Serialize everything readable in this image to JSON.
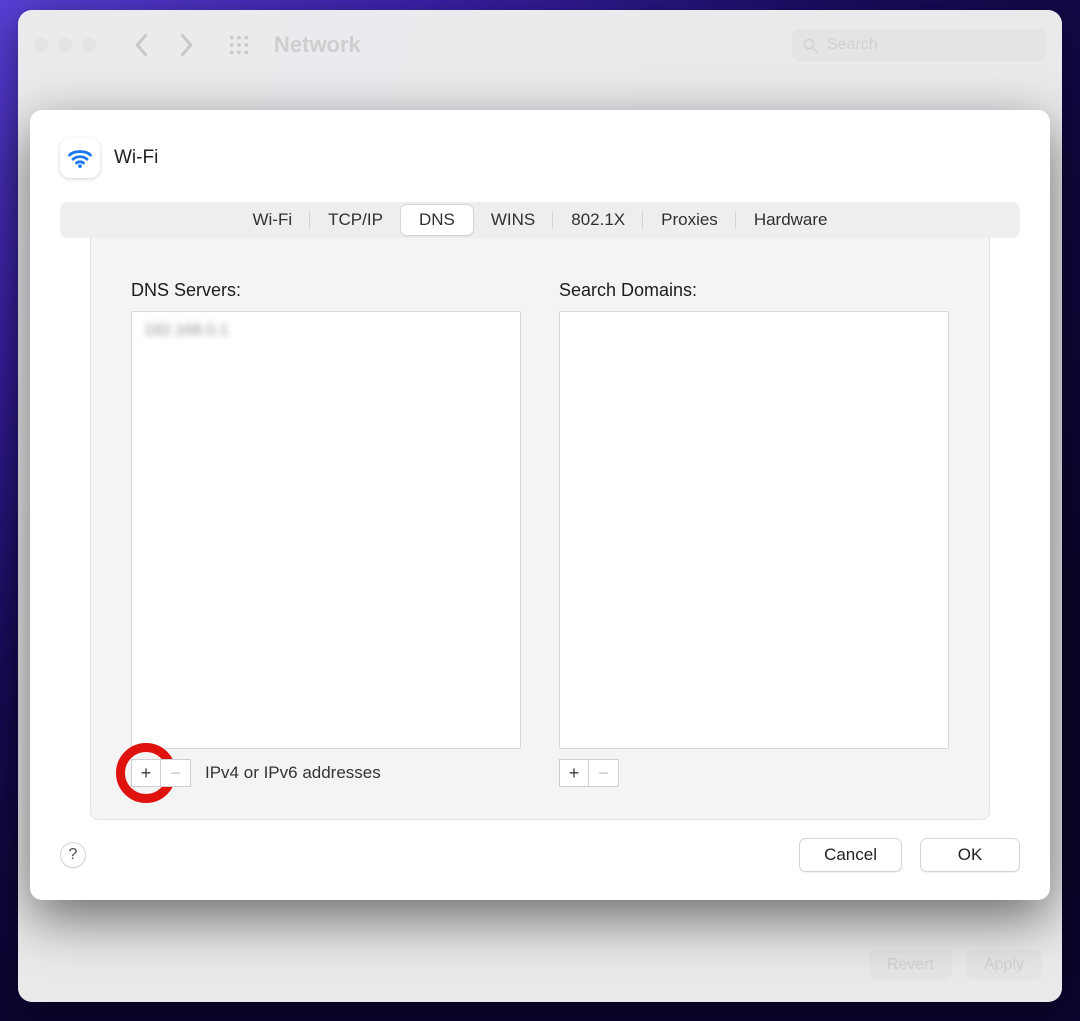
{
  "parent": {
    "title": "Network",
    "search_placeholder": "Search",
    "revert_label": "Revert",
    "apply_label": "Apply"
  },
  "sheet": {
    "title": "Wi-Fi",
    "tabs": [
      "Wi-Fi",
      "TCP/IP",
      "DNS",
      "WINS",
      "802.1X",
      "Proxies",
      "Hardware"
    ],
    "active_tab_index": 2
  },
  "dns": {
    "servers_label": "DNS Servers:",
    "domains_label": "Search Domains:",
    "servers_entry": "192.168.0.1",
    "hint": "IPv4 or IPv6 addresses"
  },
  "buttons": {
    "plus": "+",
    "minus": "−",
    "help": "?",
    "cancel": "Cancel",
    "ok": "OK"
  }
}
